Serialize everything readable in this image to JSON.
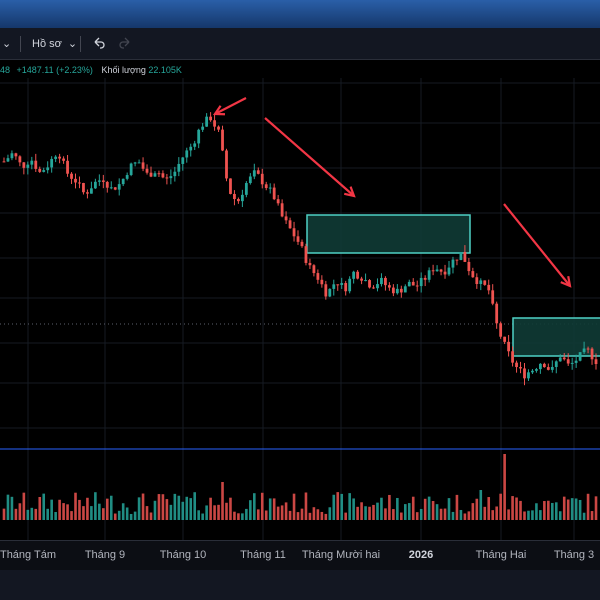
{
  "toolbar": {
    "dropdown_caret": "⌄",
    "profile_label": "Hồ sơ",
    "undo_icon": "undo-icon",
    "redo_icon": "redo-icon"
  },
  "legend": {
    "value_partial": "48",
    "change": "+1487.11 (+2.23%)",
    "volume_label": "Khối lượng",
    "volume_value": "22.105K"
  },
  "time_axis": {
    "labels": [
      "Tháng Tám",
      "Tháng 9",
      "Tháng 10",
      "Tháng 11",
      "Tháng Mười hai",
      "2026",
      "Tháng Hai",
      "Tháng 3"
    ]
  },
  "colors": {
    "up": "#26a69a",
    "down": "#ef5350",
    "arrow": "#f23645",
    "zone_fill": "#0f3b35",
    "zone_border": "#4fd1c5",
    "pane_separator": "#2962ff",
    "toolbar_bg": "#131722",
    "chart_bg": "#000000"
  },
  "chart_data": {
    "type": "candlestick",
    "x_axis_labels": [
      "Tháng Tám",
      "Tháng 9",
      "Tháng 10",
      "Tháng 11",
      "Tháng Mười hai",
      "2026",
      "Tháng Hai",
      "Tháng 3"
    ],
    "price_path_relative": [
      0.8,
      0.83,
      0.78,
      0.81,
      0.76,
      0.79,
      0.84,
      0.76,
      0.73,
      0.68,
      0.72,
      0.74,
      0.7,
      0.72,
      0.78,
      0.8,
      0.75,
      0.77,
      0.73,
      0.76,
      0.82,
      0.86,
      0.93,
      0.96,
      0.9,
      0.7,
      0.65,
      0.72,
      0.76,
      0.72,
      0.68,
      0.6,
      0.55,
      0.5,
      0.42,
      0.38,
      0.32,
      0.37,
      0.34,
      0.4,
      0.38,
      0.35,
      0.37,
      0.34,
      0.33,
      0.36,
      0.35,
      0.38,
      0.42,
      0.4,
      0.44,
      0.47,
      0.4,
      0.36,
      0.34,
      0.2,
      0.12,
      0.06,
      0.03,
      0.05,
      0.08,
      0.04,
      0.1,
      0.06,
      0.09,
      0.12,
      0.08
    ],
    "consolidation_zones": 2,
    "down_trends": 3,
    "volume_spike_near": "Tháng Hai",
    "grid": true
  }
}
